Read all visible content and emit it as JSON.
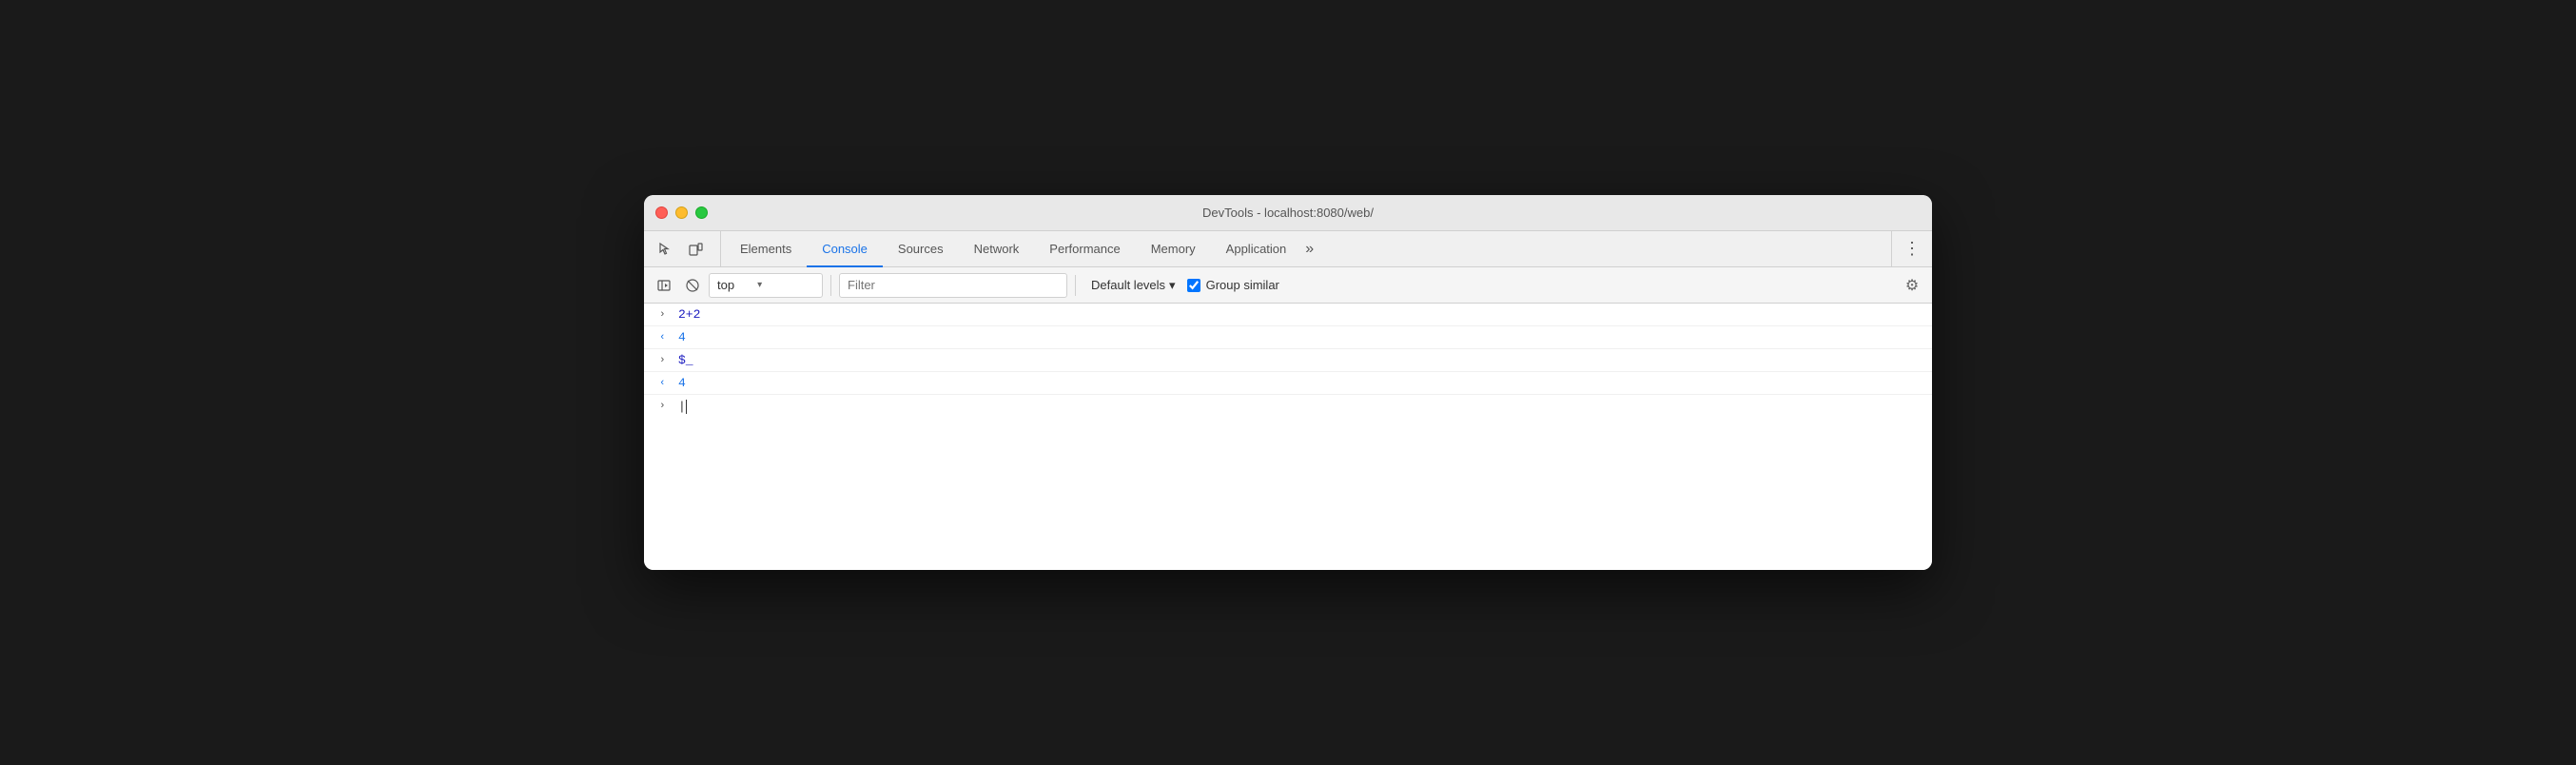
{
  "window": {
    "title": "DevTools - localhost:8080/web/"
  },
  "traffic_lights": {
    "close": "close",
    "minimize": "minimize",
    "maximize": "maximize"
  },
  "tabs": [
    {
      "id": "elements",
      "label": "Elements",
      "active": false
    },
    {
      "id": "console",
      "label": "Console",
      "active": true
    },
    {
      "id": "sources",
      "label": "Sources",
      "active": false
    },
    {
      "id": "network",
      "label": "Network",
      "active": false
    },
    {
      "id": "performance",
      "label": "Performance",
      "active": false
    },
    {
      "id": "memory",
      "label": "Memory",
      "active": false
    },
    {
      "id": "application",
      "label": "Application",
      "active": false
    }
  ],
  "more_tabs_label": "»",
  "toolbar": {
    "context_value": "top",
    "context_arrow": "▾",
    "filter_placeholder": "Filter",
    "levels_label": "Default levels",
    "levels_arrow": "▾",
    "group_similar_label": "Group similar"
  },
  "console_entries": [
    {
      "direction": "›",
      "text": "2+2",
      "text_class": "blue"
    },
    {
      "direction": "‹",
      "text": "4",
      "text_class": "return"
    },
    {
      "direction": "›",
      "text": "$_",
      "text_class": "blue"
    },
    {
      "direction": "‹",
      "text": "4",
      "text_class": "return"
    }
  ],
  "input_prompt": "›",
  "input_cursor": "|",
  "icons": {
    "inspect": "⬚",
    "device": "⧉",
    "clear": "⊘",
    "sidebar": "▶|",
    "more_vert": "⋮",
    "gear": "⚙"
  }
}
